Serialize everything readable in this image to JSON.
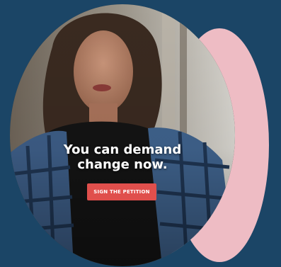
{
  "hero": {
    "headline": "You can demand\nchange now.",
    "cta_label": "SIGN THE PETITION"
  },
  "colors": {
    "background": "#1b4566",
    "accent_pink": "#eebcc4",
    "cta": "#e04f4c",
    "text": "#ffffff"
  },
  "image": {
    "icon": "woman-portrait-photo"
  }
}
